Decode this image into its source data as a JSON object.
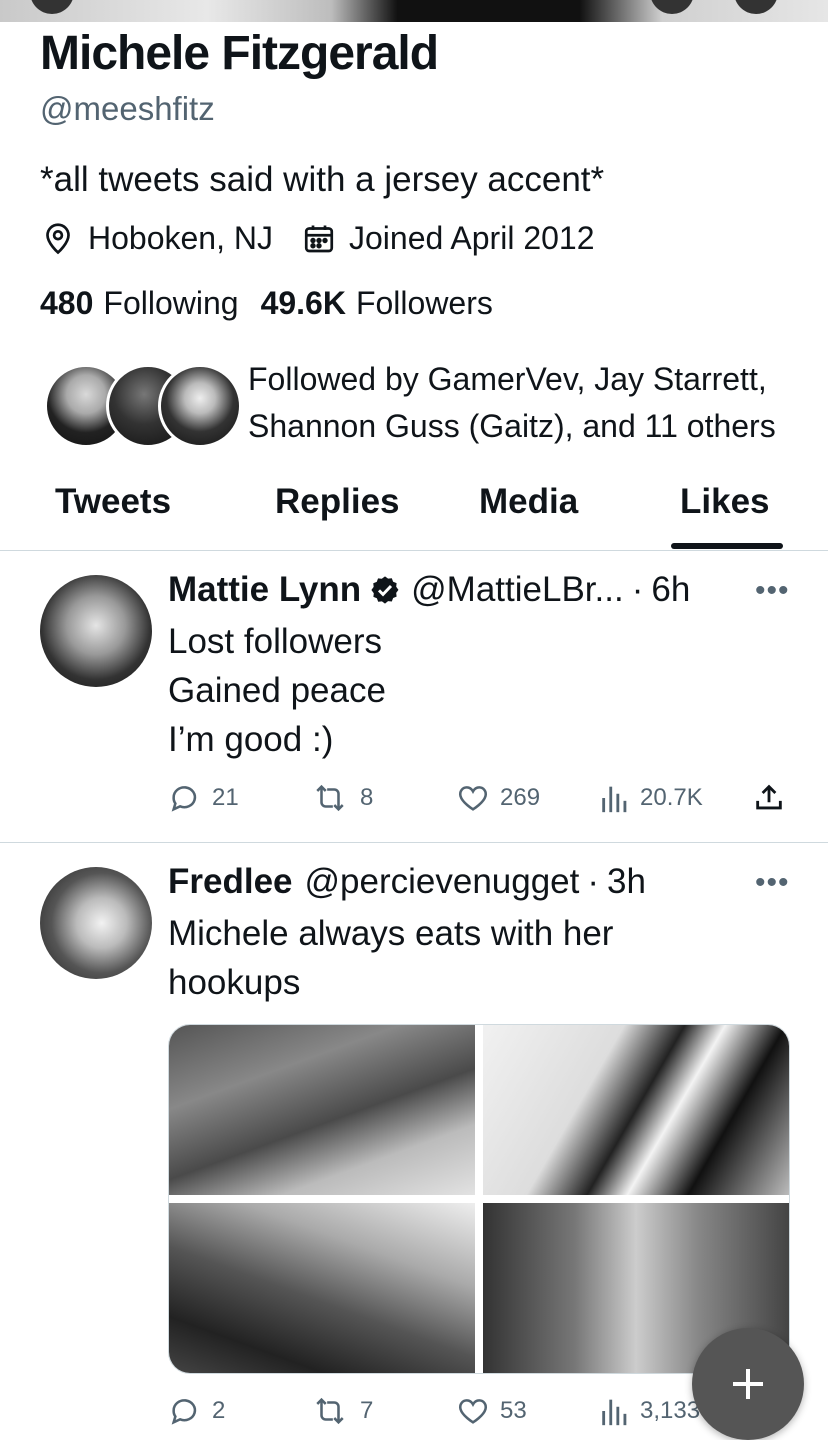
{
  "profile": {
    "name": "Michele Fitzgerald",
    "handle": "@meeshfitz",
    "bio": "*all tweets said with a jersey accent*",
    "location": "Hoboken, NJ",
    "joined": "Joined April 2012",
    "following_count": "480",
    "following_label": "Following",
    "followers_count": "49.6K",
    "followers_label": "Followers",
    "followed_by": "Followed by GamerVev, Jay Starrett, Shannon Guss (Gaitz), and 11 others",
    "followed_by_line1": "Followed by GamerVev, Jay Starrett,",
    "followed_by_line2": "Shannon Guss (Gaitz), and 11 others"
  },
  "tabs": [
    {
      "label": "Tweets",
      "active": false
    },
    {
      "label": "Replies",
      "active": false
    },
    {
      "label": "Media",
      "active": false
    },
    {
      "label": "Likes",
      "active": true
    }
  ],
  "tweets": [
    {
      "name": "Mattie Lynn",
      "verified": true,
      "handle": "@MattieLBr...",
      "time": "6h",
      "lines": [
        "Lost followers",
        "Gained peace",
        "I’m good :)"
      ],
      "replies": "21",
      "retweets": "8",
      "likes": "269",
      "views": "20.7K"
    },
    {
      "name": "Fredlee",
      "verified": false,
      "handle": "@percievenugget",
      "time": "3h",
      "lines": [
        "Michele always eats with her",
        "hookups"
      ],
      "replies": "2",
      "retweets": "7",
      "likes": "53",
      "views": "3,133"
    }
  ],
  "fab": {
    "icon": "plus-icon"
  },
  "colors": {
    "text": "#0f1419",
    "secondary": "#536471",
    "divider": "#cfd9de",
    "fab": "#555555"
  }
}
